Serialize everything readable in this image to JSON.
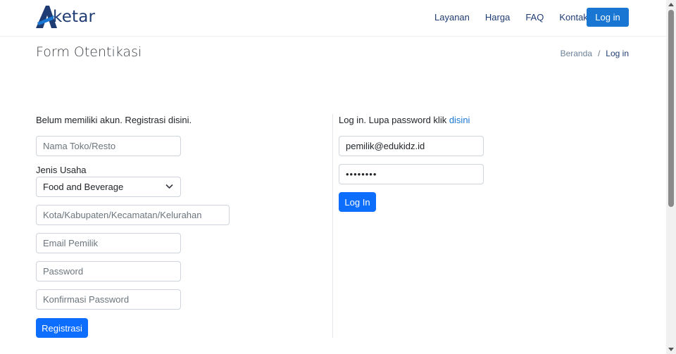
{
  "brand": {
    "name": "ketar",
    "accent": "#1976d2",
    "dark": "#1f3b73"
  },
  "nav": {
    "links": [
      "Layanan",
      "Harga",
      "FAQ",
      "Kontak"
    ],
    "login_label": "Log in"
  },
  "page": {
    "title": "Form Otentikasi",
    "breadcrumb": {
      "home": "Beranda",
      "separator": "/",
      "current": "Log in"
    }
  },
  "register": {
    "intro": "Belum memiliki akun. Registrasi disini.",
    "store_name_placeholder": "Nama Toko/Resto",
    "business_type_label": "Jenis Usaha",
    "business_type_value": "Food and Beverage",
    "location_placeholder": "Kota/Kabupaten/Kecamatan/Kelurahan",
    "email_placeholder": "Email Pemilik",
    "password_placeholder": "Password",
    "confirm_placeholder": "Konfirmasi Password",
    "submit_label": "Registrasi"
  },
  "login": {
    "intro_text": "Log in. Lupa password klik ",
    "intro_link": "disini",
    "email_value": "pemilik@edukidz.id",
    "password_value": "••••••••",
    "submit_label": "Log In"
  }
}
